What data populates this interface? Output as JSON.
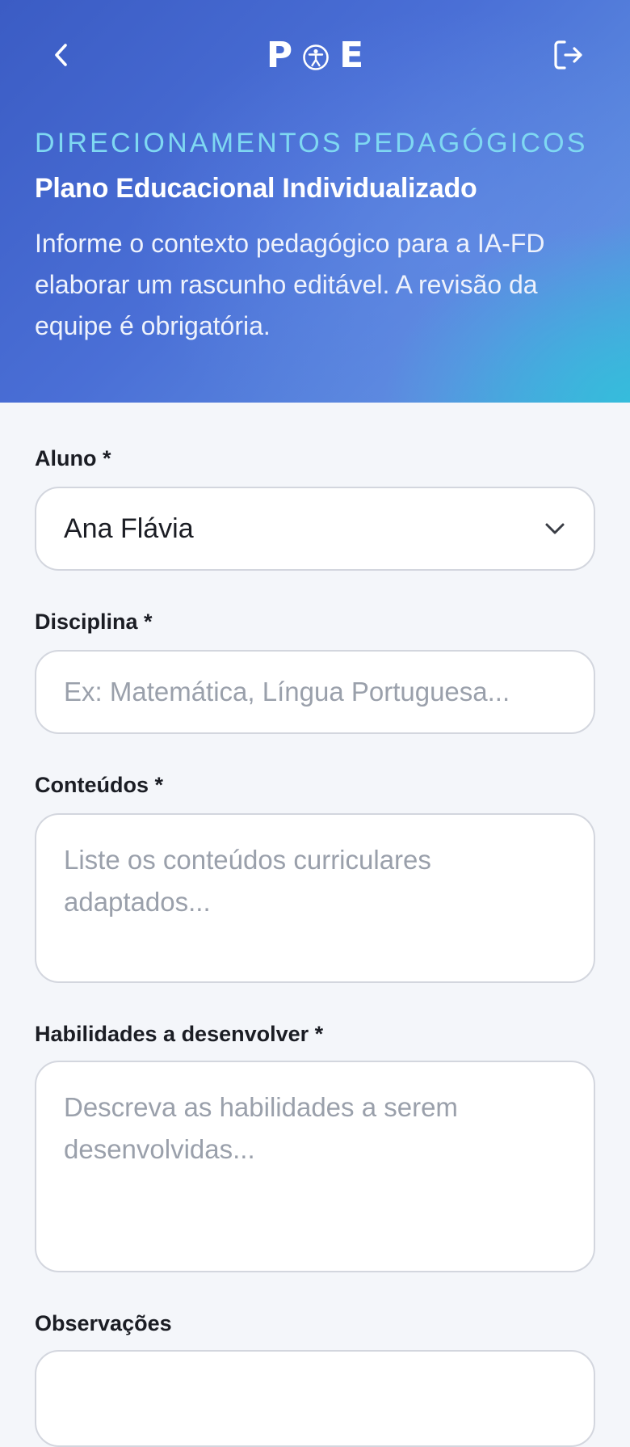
{
  "header": {
    "logo_left": "P",
    "logo_right": "E",
    "eyebrow": "DIRECIONAMENTOS PEDAGÓGICOS",
    "title": "Plano Educacional Individualizado",
    "description": "Informe o contexto pedagógico para a IA-FD elaborar um rascunho editável. A revisão da equipe é obrigatória.",
    "back_icon": "chevron-left-icon",
    "logout_icon": "logout-icon",
    "logo_icon": "accessibility-icon"
  },
  "form": {
    "aluno": {
      "label": "Aluno *",
      "value": "Ana Flávia"
    },
    "disciplina": {
      "label": "Disciplina *",
      "placeholder": "Ex: Matemática, Língua Portuguesa..."
    },
    "conteudos": {
      "label": "Conteúdos *",
      "placeholder": "Liste os conteúdos curriculares adaptados..."
    },
    "habilidades": {
      "label": "Habilidades a desenvolver *",
      "placeholder": "Descreva as habilidades a serem desenvolvidas..."
    },
    "observacoes": {
      "label": "Observações"
    }
  },
  "colors": {
    "header_gradient_start": "#3b5cc4",
    "header_gradient_end": "#47a9dc",
    "eyebrow": "#7fd8f2",
    "page_background": "#f4f6fa",
    "field_border": "#d3d6de",
    "placeholder": "#9aa0ab"
  }
}
